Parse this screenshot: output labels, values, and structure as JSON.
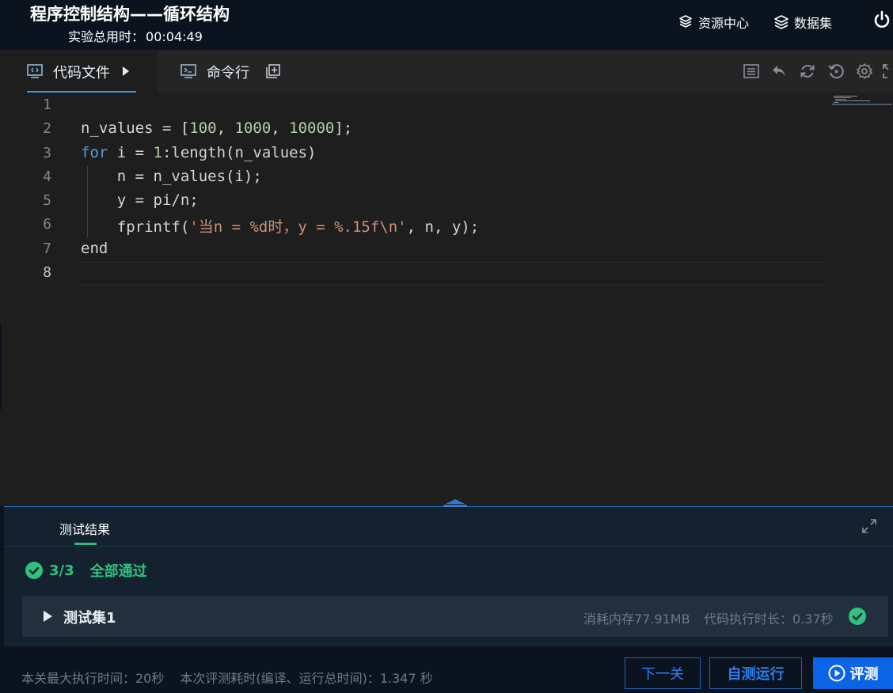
{
  "header": {
    "title": "程序控制结构——循环结构",
    "timer_label": "实验总用时：",
    "timer_value": "00:04:49",
    "links": [
      {
        "label": "资源中心",
        "icon": "box-icon"
      },
      {
        "label": "数据集",
        "icon": "layers-icon"
      }
    ],
    "power_icon": "power-icon"
  },
  "editor": {
    "tabs": [
      {
        "label": "代码文件",
        "icon": "code-file-icon",
        "active": true
      },
      {
        "label": "命令行",
        "icon": "terminal-icon",
        "active": false
      }
    ],
    "toolbar_icons": [
      "list-icon",
      "undo-icon",
      "refresh-icon",
      "restore-icon",
      "gear-icon",
      "fullscreen-icon"
    ],
    "line_numbers": [
      "1",
      "2",
      "3",
      "4",
      "5",
      "6",
      "7",
      "8"
    ],
    "code": {
      "line2": {
        "a": "n_values = [",
        "n1": "100",
        "c1": ", ",
        "n2": "1000",
        "c2": ", ",
        "n3": "10000",
        "z": "];"
      },
      "line3": {
        "kw": "for",
        "a": " i = ",
        "n1": "1",
        "z": ":length(n_values)"
      },
      "line4": {
        "a": "    n = n_values(i);"
      },
      "line5": {
        "a": "    y = pi/n;"
      },
      "line6": {
        "a": "    fprintf(",
        "s": "'当n = %d时，y = %.15f\\n'",
        "z": ", n, y);"
      },
      "line7": {
        "kw": "end"
      }
    }
  },
  "results": {
    "tab_label": "测试结果",
    "pass_count": "3/3",
    "pass_text": "全部通过",
    "test_set": {
      "name": "测试集1",
      "memory": "消耗内存77.91MB",
      "duration": "代码执行时长：0.37秒"
    }
  },
  "footer": {
    "max_time": "本关最大执行时间：20秒",
    "eval_time": "本次评测耗时(编译、运行总时间)：1.347 秒",
    "next_label": "下一关",
    "self_run_label": "自测运行",
    "judge_label": "评测"
  },
  "colors": {
    "accent_blue": "#0b63e5",
    "success_green": "#2ec27e",
    "header_bg": "#0b141e",
    "editor_bg": "#1e1e1e"
  }
}
